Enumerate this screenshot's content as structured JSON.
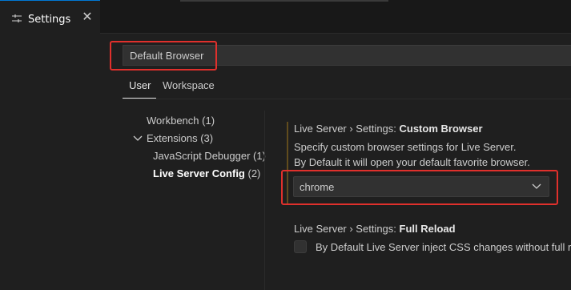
{
  "tab": {
    "label": "Settings",
    "icon": "settings-sliders-icon",
    "close": "✕"
  },
  "search": {
    "value": "Default Browser"
  },
  "scope_tabs": {
    "user": "User",
    "workspace": "Workspace"
  },
  "toc": {
    "workbench": {
      "label": "Workbench",
      "count": "(1)"
    },
    "extensions": {
      "label": "Extensions",
      "count": "(3)"
    },
    "js_debugger": {
      "label": "JavaScript Debugger",
      "count": "(1)"
    },
    "live_server": {
      "label": "Live Server Config",
      "count": "(2)"
    }
  },
  "settings": {
    "custom_browser": {
      "category": "Live Server › Settings: ",
      "name": "Custom Browser",
      "desc1": "Specify custom browser settings for Live Server.",
      "desc2": "By Default it will open your default favorite browser.",
      "value": "chrome"
    },
    "full_reload": {
      "category": "Live Server › Settings: ",
      "name": "Full Reload",
      "desc": "By Default Live Server inject CSS changes without full re"
    }
  },
  "colors": {
    "highlight": "#e0302c",
    "accent": "#0078d4",
    "modified_bar": "#614c1d"
  }
}
